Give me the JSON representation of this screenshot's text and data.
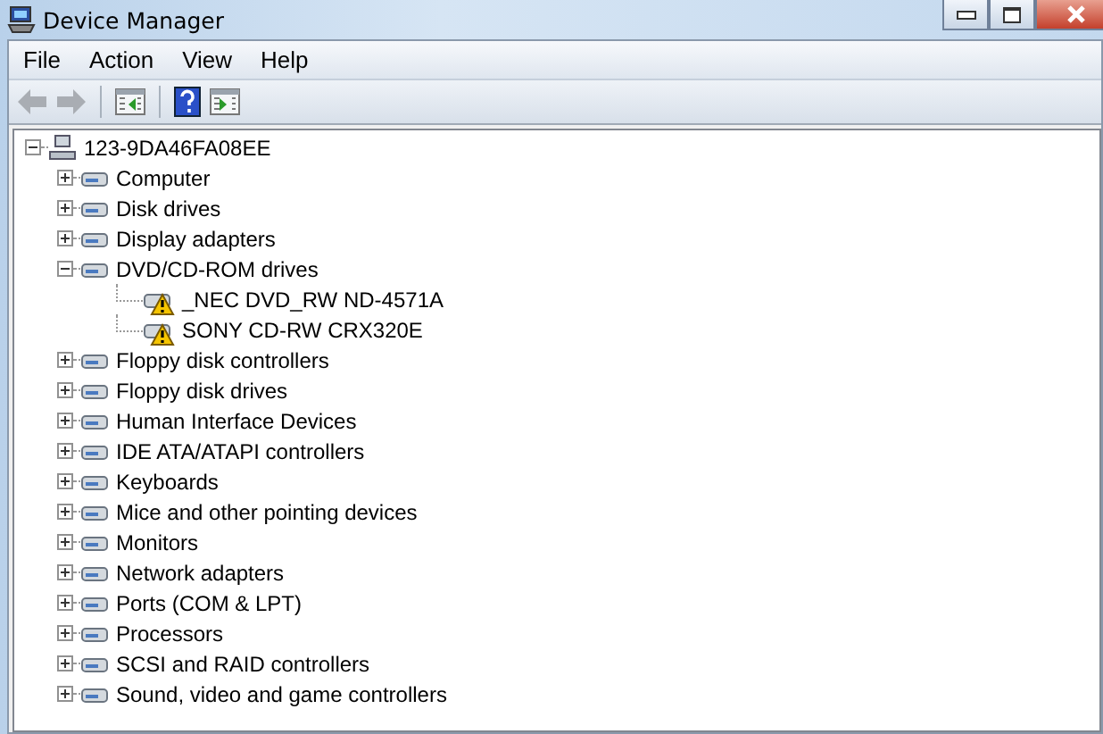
{
  "window": {
    "title": "Device Manager"
  },
  "menu": [
    "File",
    "Action",
    "View",
    "Help"
  ],
  "toolbar": [
    {
      "kind": "back",
      "disabled": true
    },
    {
      "kind": "forward",
      "disabled": true
    },
    {
      "kind": "separator"
    },
    {
      "kind": "pane-left",
      "disabled": false
    },
    {
      "kind": "separator"
    },
    {
      "kind": "help",
      "disabled": false
    },
    {
      "kind": "pane-right",
      "disabled": false
    }
  ],
  "tree": {
    "label": "123-9DA46FA08EE",
    "expanded": true,
    "children": [
      {
        "label": "Computer",
        "expanded": false
      },
      {
        "label": "Disk drives",
        "expanded": false
      },
      {
        "label": "Display adapters",
        "expanded": false
      },
      {
        "label": "DVD/CD-ROM drives",
        "expanded": true,
        "children": [
          {
            "label": "_NEC DVD_RW ND-4571A",
            "warning": true
          },
          {
            "label": "SONY CD-RW  CRX320E",
            "warning": true
          }
        ]
      },
      {
        "label": "Floppy disk controllers",
        "expanded": false
      },
      {
        "label": "Floppy disk drives",
        "expanded": false
      },
      {
        "label": "Human Interface Devices",
        "expanded": false
      },
      {
        "label": "IDE ATA/ATAPI controllers",
        "expanded": false
      },
      {
        "label": "Keyboards",
        "expanded": false
      },
      {
        "label": "Mice and other pointing devices",
        "expanded": false
      },
      {
        "label": "Monitors",
        "expanded": false
      },
      {
        "label": "Network adapters",
        "expanded": false
      },
      {
        "label": "Ports (COM & LPT)",
        "expanded": false
      },
      {
        "label": "Processors",
        "expanded": false
      },
      {
        "label": "SCSI and RAID controllers",
        "expanded": false
      },
      {
        "label": "Sound, video and game controllers",
        "expanded": false
      }
    ]
  }
}
